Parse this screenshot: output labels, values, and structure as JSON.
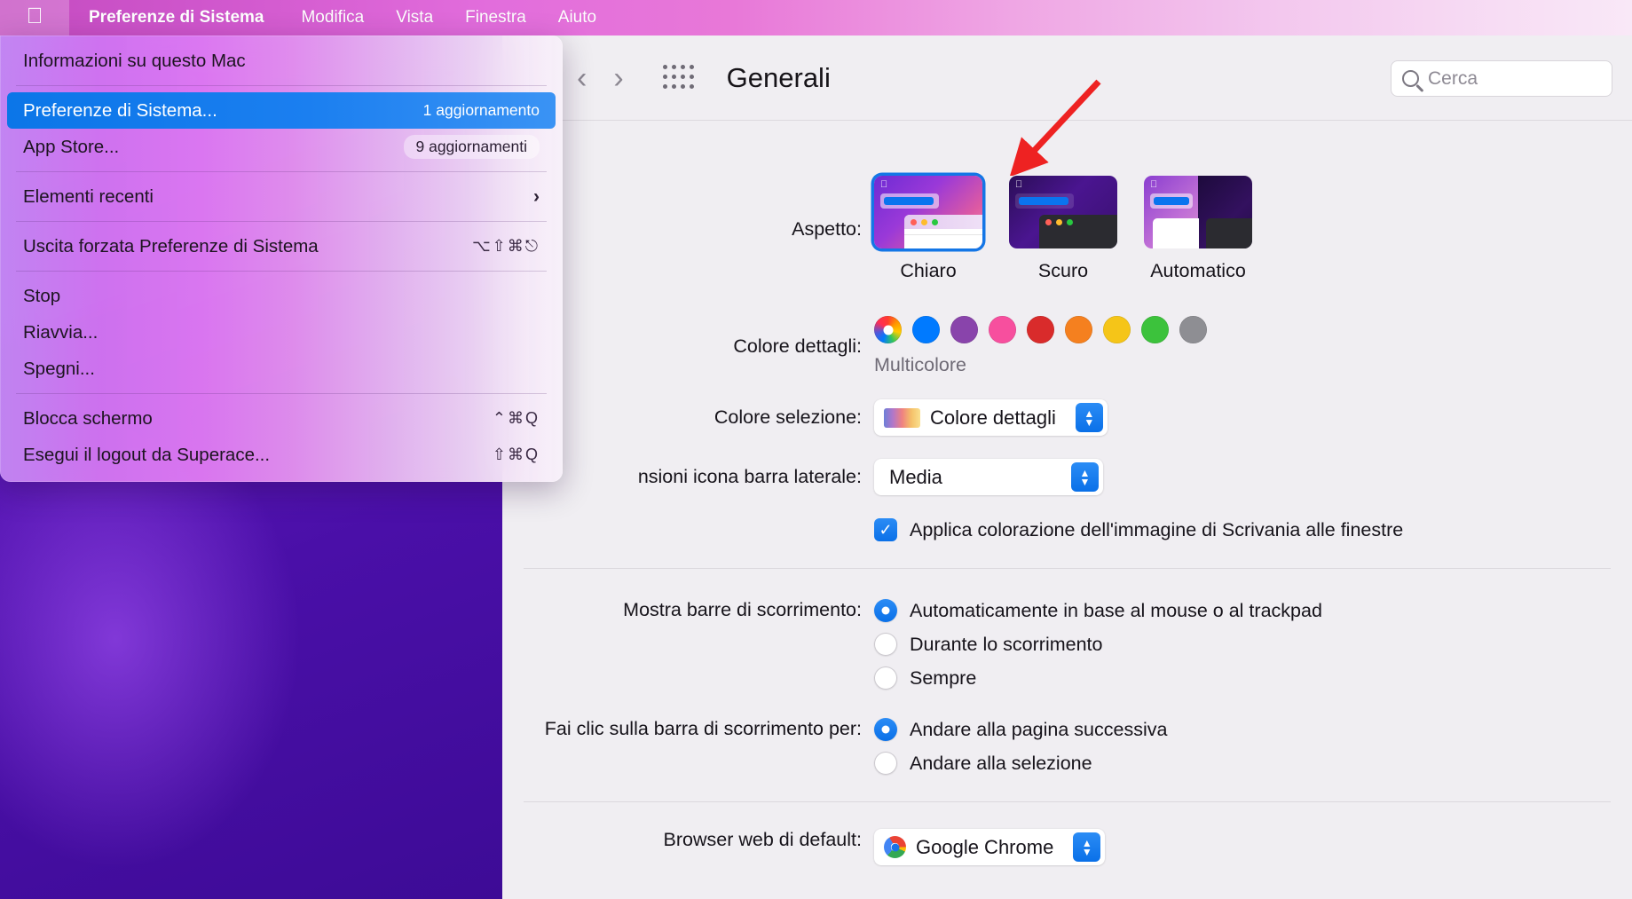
{
  "menubar": {
    "apple_icon": "apple-logo",
    "items": [
      {
        "label": "Preferenze di Sistema",
        "bold": true
      },
      {
        "label": "Modifica",
        "bold": false
      },
      {
        "label": "Vista",
        "bold": false
      },
      {
        "label": "Finestra",
        "bold": false
      },
      {
        "label": "Aiuto",
        "bold": false
      }
    ]
  },
  "apple_menu": {
    "items": [
      {
        "label": "Informazioni su questo Mac",
        "trail": "",
        "badge": "",
        "selected": false,
        "submenu": false
      },
      {
        "separator": true
      },
      {
        "label": "Preferenze di Sistema...",
        "trail": "1 aggiornamento",
        "badge": "",
        "selected": true,
        "submenu": false
      },
      {
        "label": "App Store...",
        "trail": "",
        "badge": "9 aggiornamenti",
        "selected": false,
        "submenu": false
      },
      {
        "separator": true
      },
      {
        "label": "Elementi recenti",
        "trail": "",
        "badge": "",
        "selected": false,
        "submenu": true
      },
      {
        "separator": true
      },
      {
        "label": "Uscita forzata Preferenze di Sistema",
        "trail": "⌥⇧⌘⎋",
        "badge": "",
        "selected": false,
        "submenu": false
      },
      {
        "separator": true
      },
      {
        "label": "Stop",
        "trail": "",
        "badge": "",
        "selected": false,
        "submenu": false
      },
      {
        "label": "Riavvia...",
        "trail": "",
        "badge": "",
        "selected": false,
        "submenu": false
      },
      {
        "label": "Spegni...",
        "trail": "",
        "badge": "",
        "selected": false,
        "submenu": false
      },
      {
        "separator": true
      },
      {
        "label": "Blocca schermo",
        "trail": "⌃⌘Q",
        "badge": "",
        "selected": false,
        "submenu": false
      },
      {
        "label": "Esegui il logout da Superace...",
        "trail": "⇧⌘Q",
        "badge": "",
        "selected": false,
        "submenu": false
      }
    ]
  },
  "toolbar": {
    "back_icon": "chevron-left-icon",
    "forward_icon": "chevron-right-icon",
    "grid_icon": "grid-icon",
    "title": "Generali",
    "search_placeholder": "Cerca"
  },
  "general": {
    "appearance": {
      "label": "Aspetto:",
      "options": [
        {
          "name": "Chiaro",
          "selected": true
        },
        {
          "name": "Scuro",
          "selected": false
        },
        {
          "name": "Automatico",
          "selected": false
        }
      ]
    },
    "accent": {
      "label": "Colore dettagli:",
      "caption": "Multicolore",
      "colors": [
        {
          "name": "Multicolore",
          "hex": "multi",
          "selected": true
        },
        {
          "name": "Blu",
          "hex": "#007aff",
          "selected": false
        },
        {
          "name": "Viola",
          "hex": "#8944ab",
          "selected": false
        },
        {
          "name": "Rosa",
          "hex": "#f74f9e",
          "selected": false
        },
        {
          "name": "Rosso",
          "hex": "#d92b2b",
          "selected": false
        },
        {
          "name": "Arancione",
          "hex": "#f5801f",
          "selected": false
        },
        {
          "name": "Giallo",
          "hex": "#f5c518",
          "selected": false
        },
        {
          "name": "Verde",
          "hex": "#3cc23c",
          "selected": false
        },
        {
          "name": "Grafite",
          "hex": "#8e8e93",
          "selected": false
        }
      ]
    },
    "highlight": {
      "label": "Colore selezione:",
      "value": "Colore dettagli"
    },
    "sidebar_icon_size": {
      "label": "nsioni icona barra laterale:",
      "value": "Media"
    },
    "wallpaper_tint": {
      "checked": true,
      "label": "Applica colorazione dell'immagine di Scrivania alle finestre"
    },
    "show_scrollbars": {
      "label": "Mostra barre di scorrimento:",
      "options": [
        {
          "label": "Automaticamente in base al mouse o al trackpad",
          "selected": true
        },
        {
          "label": "Durante lo scorrimento",
          "selected": false
        },
        {
          "label": "Sempre",
          "selected": false
        }
      ]
    },
    "click_scrollbar": {
      "label": "Fai clic sulla barra di scorrimento per:",
      "options": [
        {
          "label": "Andare alla pagina successiva",
          "selected": true
        },
        {
          "label": "Andare alla selezione",
          "selected": false
        }
      ]
    },
    "default_browser": {
      "label": "Browser web di default:",
      "value": "Google Chrome"
    }
  },
  "annotation": {
    "arrow_color": "#ee2222",
    "points_to": "Scuro"
  }
}
